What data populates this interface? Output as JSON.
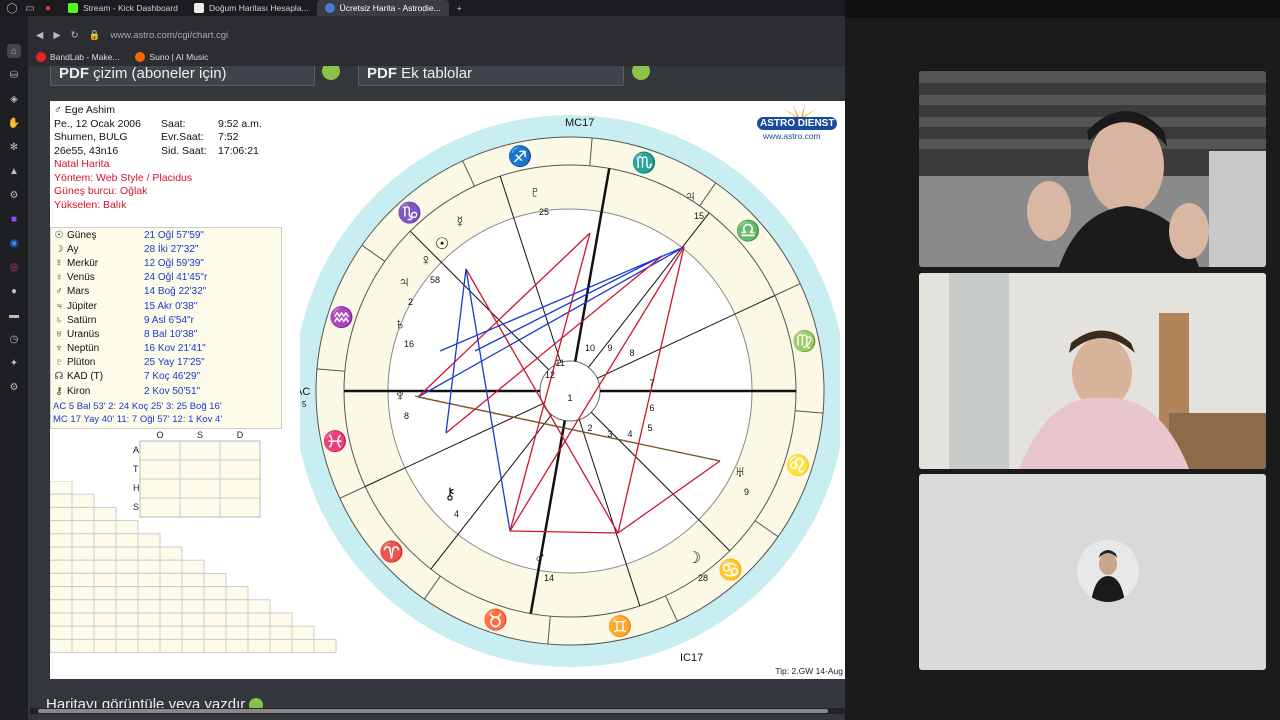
{
  "tabs": [
    {
      "label": "Stream - Kick Dashboard",
      "color": "#53fc18"
    },
    {
      "label": "Doğum Haritası Hesapla...",
      "color": "#ffffff"
    },
    {
      "label": "Ücretsiz Harita - Astrodie...",
      "color": "#4a7bd1"
    }
  ],
  "address": {
    "url": "www.astro.com/cgi/chart.cgi"
  },
  "bookmarks": [
    {
      "label": "BandLab - Make...",
      "color": "#e22"
    },
    {
      "label": "Suno | AI Music",
      "color": "#f60"
    }
  ],
  "page": {
    "pdf1": {
      "prefix": "PDF",
      "label": "çizim (aboneler için)"
    },
    "pdf2": {
      "prefix": "PDF",
      "label": "Ek tablolar"
    },
    "footer": "Haritayı görüntüle veya yazdır"
  },
  "chart_info": {
    "name": "Ege Ashim",
    "date": "Pe., 12 Ocak 2006",
    "place": "Shumen, BULG",
    "coords": "26e55, 43n16",
    "saat_label": "Saat:",
    "saat": "9:52 a.m.",
    "evr_label": "Evr.Saat:",
    "evr": "7:52",
    "sid_label": "Sid. Saat:",
    "sid": "17:06:21",
    "type": "Natal Harita",
    "method": "Yöntem: Web Style / Placidus",
    "sun_sign": "Güneş burcu: Oğlak",
    "ascendant": "Yükselen: Balık"
  },
  "planets": [
    {
      "sym": "☉",
      "name": "Güneş",
      "pos": "21 Oğl 57'59\""
    },
    {
      "sym": "☽",
      "name": "Ay",
      "pos": "28 İki 27'32\""
    },
    {
      "sym": "☿",
      "name": "Merkür",
      "pos": "12 Oğl 59'39\""
    },
    {
      "sym": "♀",
      "name": "Venüs",
      "pos": "24 Oğl 41'45\"r"
    },
    {
      "sym": "♂",
      "name": "Mars",
      "pos": "14 Boğ 22'32\""
    },
    {
      "sym": "♃",
      "name": "Jüpiter",
      "pos": "15 Akr 0'38\""
    },
    {
      "sym": "♄",
      "name": "Satürn",
      "pos": "9 Asl 6'54\"r"
    },
    {
      "sym": "♅",
      "name": "Uranüs",
      "pos": "8 Bal 10'38\""
    },
    {
      "sym": "♆",
      "name": "Neptün",
      "pos": "16 Kov 21'41\""
    },
    {
      "sym": "♇",
      "name": "Plüton",
      "pos": "25 Yay 17'25\""
    },
    {
      "sym": "☊",
      "name": "KAD (T)",
      "pos": "7 Koç 46'29\""
    },
    {
      "sym": "⚷",
      "name": "Kiron",
      "pos": "2 Kov 50'51\""
    }
  ],
  "houses_line1": "AC  5 Bal 53'   2: 24 Koç 25'   3: 25 Boğ 16'",
  "houses_line2": "MC 17 Yay 40'  11:  7 Oğl 57'  12:  1 Kov  4'",
  "element_table": {
    "cols": [
      "O",
      "S",
      "D"
    ],
    "rows": [
      "A",
      "T",
      "H",
      "S"
    ]
  },
  "wheel_labels": {
    "mc": "MC",
    "mc_deg": "17",
    "ac": "AC",
    "ac_deg": "5",
    "ic": "IC",
    "ic_deg": "17"
  },
  "logo": {
    "brand": "ASTRO DIENST",
    "www": "www.astro.com"
  },
  "tip": "Tip: 2.GW  14-Aug",
  "colors": {
    "red": "#d2142c",
    "blue": "#1a3ad1",
    "green": "#2a9a2a",
    "ring": "#c8eef2",
    "cream": "#fbf8e6"
  }
}
